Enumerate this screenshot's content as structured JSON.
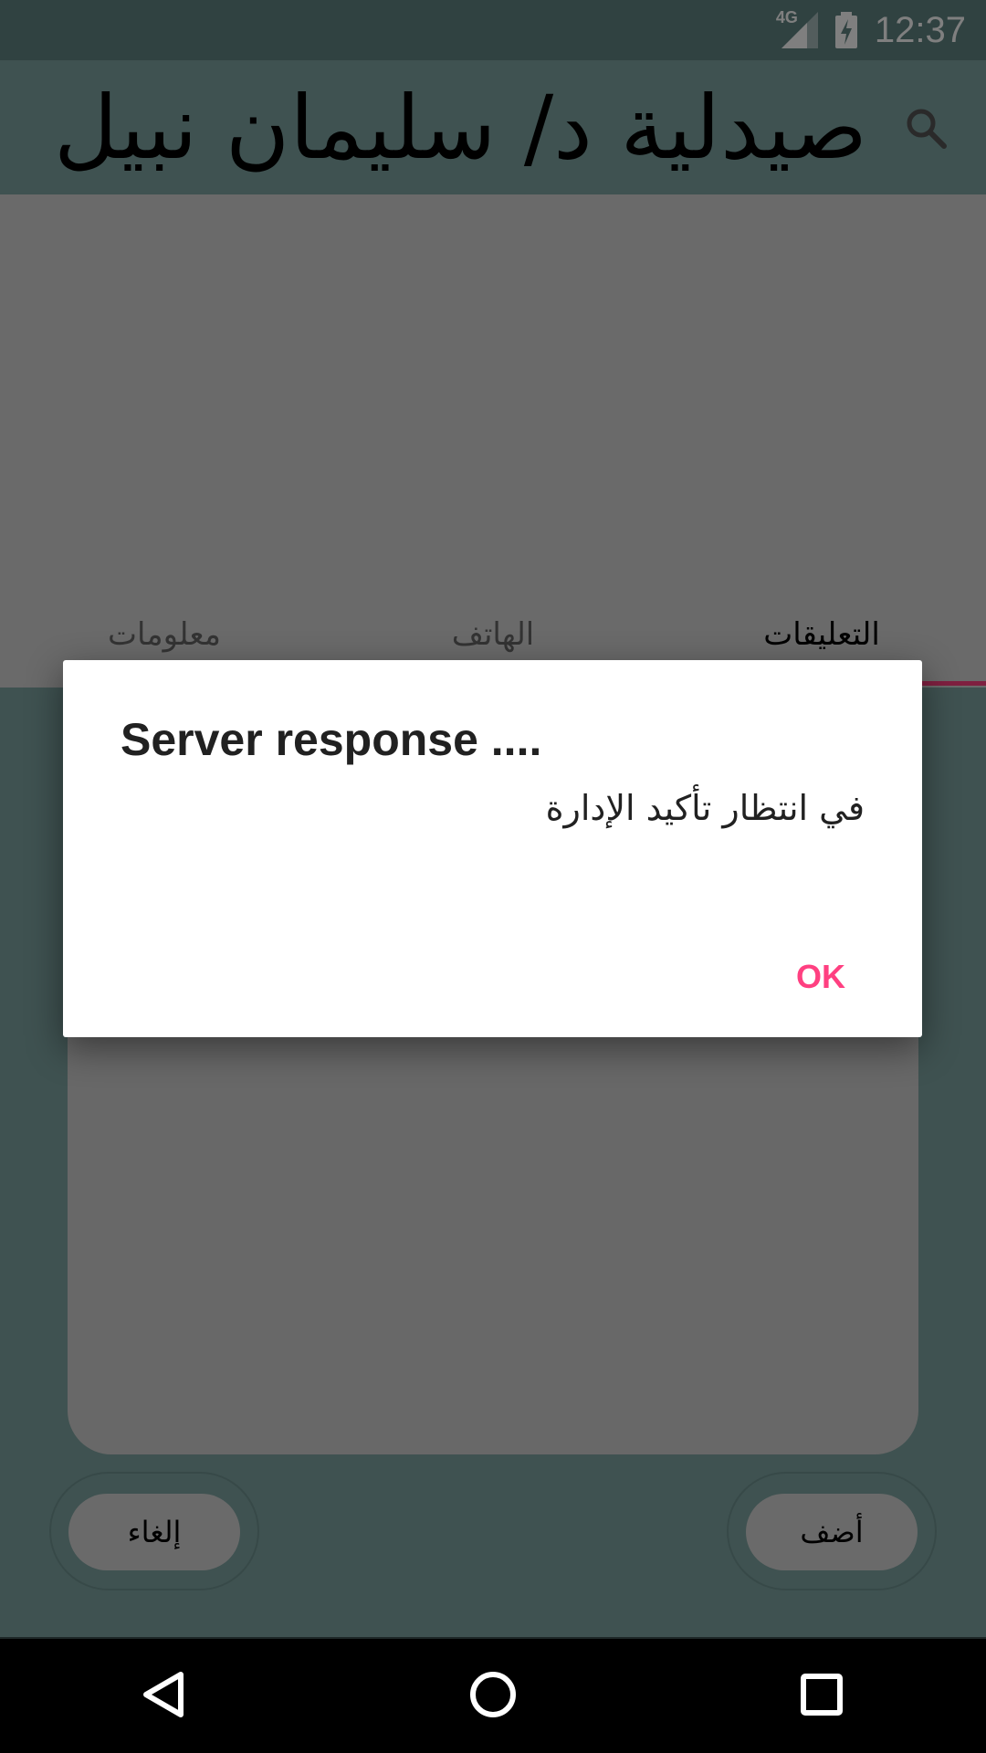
{
  "status_bar": {
    "network_label": "4G",
    "time": "12:37"
  },
  "app_bar": {
    "title": "صيدلية د/ سليمان نبيل",
    "search_icon": "search-icon"
  },
  "tabs": [
    {
      "label": "التعليقات",
      "active": true
    },
    {
      "label": "الهاتف",
      "active": false
    },
    {
      "label": "معلومات",
      "active": false
    }
  ],
  "actions": {
    "add_label": "أضف",
    "cancel_label": "إلغاء"
  },
  "dialog": {
    "title": "Server response ....",
    "message": "في انتظار تأكيد الإدارة",
    "ok_label": "OK"
  },
  "colors": {
    "accent": "#ff4081",
    "primary": "#7fa4a2",
    "primary_dark": "#608482"
  },
  "nav_bar": {
    "back_icon": "back-triangle-icon",
    "home_icon": "home-circle-icon",
    "recents_icon": "recents-square-icon"
  }
}
